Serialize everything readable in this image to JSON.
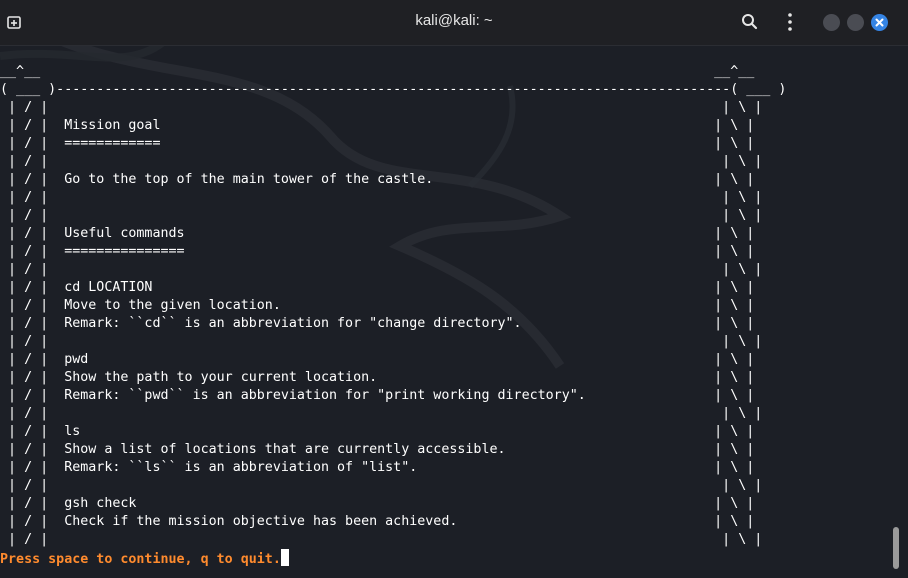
{
  "window": {
    "title": "kali@kali: ~",
    "icons": {
      "new_tab": "new-tab-icon",
      "search": "search-icon",
      "menu": "kebab-menu-icon",
      "minimize": "minimize-icon",
      "maximize": "maximize-icon",
      "close": "close-icon"
    },
    "colors": {
      "close": "#3584e4",
      "titlebar": "#1f2024"
    }
  },
  "terminal": {
    "background": "#1c1f26",
    "prompt_color": "#ff8b2e",
    "screen_text": "__^__                                                                                    __^__\n( ___ )------------------------------------------------------------------------------------( ___ )\n | / |                                                                                    | \\ |\n | / |  Mission goal                                                                     | \\ |\n | / |  ============                                                                     | \\ |\n | / |                                                                                    | \\ |\n | / |  Go to the top of the main tower of the castle.                                   | \\ |\n | / |                                                                                    | \\ |\n | / |                                                                                    | \\ |\n | / |  Useful commands                                                                  | \\ |\n | / |  ===============                                                                  | \\ |\n | / |                                                                                    | \\ |\n | / |  cd LOCATION                                                                      | \\ |\n | / |  Move to the given location.                                                      | \\ |\n | / |  Remark: ``cd`` is an abbreviation for \"change directory\".                        | \\ |\n | / |                                                                                    | \\ |\n | / |  pwd                                                                              | \\ |\n | / |  Show the path to your current location.                                          | \\ |\n | / |  Remark: ``pwd`` is an abbreviation for \"print working directory\".                | \\ |\n | / |                                                                                    | \\ |\n | / |  ls                                                                               | \\ |\n | / |  Show a list of locations that are currently accessible.                          | \\ |\n | / |  Remark: ``ls`` is an abbreviation of \"list\".                                     | \\ |\n | / |                                                                                    | \\ |\n | / |  gsh check                                                                        | \\ |\n | / |  Check if the mission objective has been achieved.                                | \\ |\n | / |                                                                                    | \\ |",
    "pager_prompt": "Press space to continue, q to quit."
  }
}
